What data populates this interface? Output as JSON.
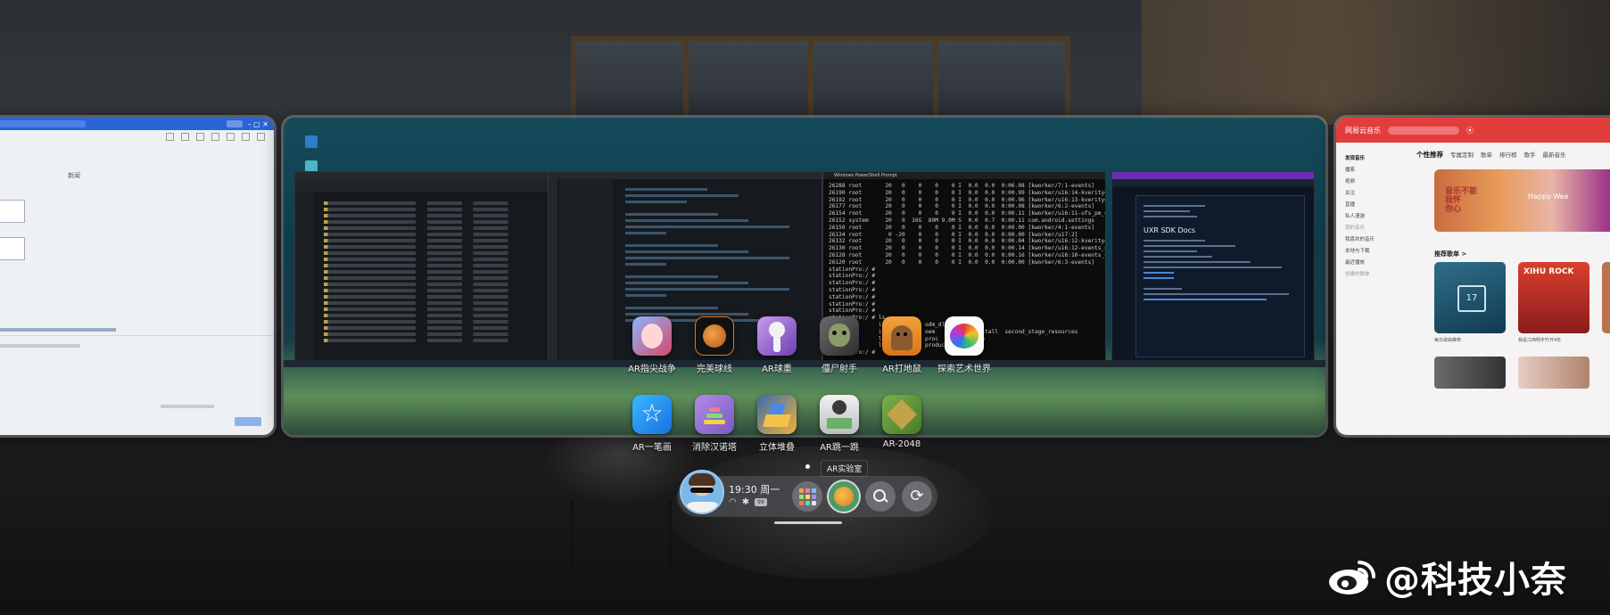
{
  "apps_row1": [
    {
      "label": "AR指尖战争",
      "icon": "fighting-game-icon"
    },
    {
      "label": "完美球线",
      "icon": "basketball-icon"
    },
    {
      "label": "AR球重",
      "icon": "bowling-icon"
    },
    {
      "label": "僵尸射手",
      "icon": "zombie-icon"
    },
    {
      "label": "AR打地鼠",
      "icon": "mole-icon"
    },
    {
      "label": "探索艺术世界",
      "icon": "art-lion-icon"
    }
  ],
  "apps_row2": [
    {
      "label": "AR一笔画",
      "icon": "star-drawing-icon"
    },
    {
      "label": "消除汉诺塔",
      "icon": "hanoi-icon"
    },
    {
      "label": "立体堆叠",
      "icon": "stacking-icon"
    },
    {
      "label": "AR跳一跳",
      "icon": "jump-icon"
    },
    {
      "label": "AR-2048",
      "icon": "2048-icon"
    }
  ],
  "tooltip": "AR实验室",
  "status": {
    "time": "19:30 周一",
    "battery": "99"
  },
  "dock": {
    "buttons": [
      {
        "icon": "app-grid-icon"
      },
      {
        "icon": "ar-lab-icon"
      },
      {
        "icon": "search-icon"
      },
      {
        "icon": "refresh-icon"
      }
    ]
  },
  "powershell": {
    "title": "Windows PowerShell Prompt",
    "text": "26288 root       20   0    0    0    0 I  0.0  0.0  0:06.08 [kworker/7:1-events]\n26190 root       20   0    0    0    0 I  0.0  0.0  0:00.99 [kworker/u16:14-kverityd]\n26192 root       20   0    0    0    0 I  0.0  0.0  0:00.96 [kworker/u16:13-kverityd]\n26177 root       20   0    0    0    0 I  0.0  0.0  0:00.08 [kworker/6:2-events]\n26154 root       20   0    0    0    0 I  0.0  0.0  0:00.11 [kworker/u16:11-ufs_pm_qos_0]\n26152 system     20   0  16G  80M 9.0M S  0.0  0.7  0:00.11 com.android.settings\n26150 root       20   0    0    0    0 I  0.0  0.0  0:00.00 [kworker/4:1-events]\n26134 root        0 -20    0    0    0 I  0.0  0.0  0:00.00 [kworker/u17:2]\n26132 root       20   0    0    0    0 I  0.0  0.0  0:00.04 [kworker/u16:12-kverityd]\n26130 root       20   0    0    0    0 I  0.0  0.0  0:00.14 [kworker/u16:12-events_unbound]\n26128 root       20   0    0    0    0 I  0.0  0.0  0:00.16 [kworker/u16:10-events_unbound]\n26120 root       20   0    0    0    0 I  0.0  0.0  0:00.00 [kworker/6:3-events]\nstationPro:/ #\nstationPro:/ #\nstationPro:/ #\nstationPro:/ #\nstationPro:/ #\nstationPro:/ #\nstationPro:/ #\nstationPro:/ # ls\ncache          init          odm_dlkm   sdcard\nconfig         init.environ  oem        postinstall  second_stage_resources\nd              linkerconfig  proc       storage\ndata           lost+found    product    sys\nstationPro:/ #"
  },
  "docs": {
    "heading": "UXR SDK Docs"
  },
  "music": {
    "app_name": "网易云音乐",
    "sidebar": [
      "发现音乐",
      "播客",
      "视频",
      "关注",
      "直播",
      "私人漫游",
      "我的音乐",
      "我喜欢的音乐",
      "本地与下载",
      "最近播放",
      "创建的歌单"
    ],
    "tabs": [
      "个性推荐",
      "专属定制",
      "歌单",
      "排行榜",
      "歌手",
      "最新音乐"
    ],
    "banner_text": "音乐不能\n我怀\n你心",
    "banner_text2": "Happy Wee",
    "section_title": "推荐歌单 >",
    "tiles": [
      {
        "caption": "每日歌曲推荐",
        "badge": "17"
      },
      {
        "caption": "我是江西明宇升开4年",
        "badge": "XIHU ROCK"
      }
    ]
  },
  "left_window": {
    "center_label": "新闻"
  },
  "watermark": "@科技小奈"
}
